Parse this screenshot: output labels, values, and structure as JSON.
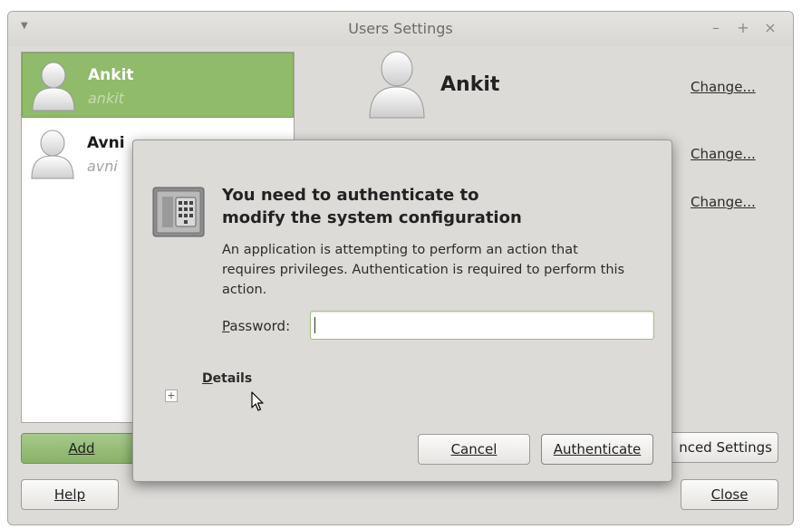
{
  "window": {
    "title": "Users Settings",
    "controls": [
      "–",
      "+",
      "×"
    ]
  },
  "users": [
    {
      "name": "Ankit",
      "login": "ankit",
      "selected": true
    },
    {
      "name": "Avni",
      "login": "avni",
      "selected": false
    }
  ],
  "details": {
    "name": "Ankit",
    "change_label": "Change..."
  },
  "buttons": {
    "add": "Add",
    "advanced_settings": "nced Settings",
    "help": "Help",
    "close": "Close"
  },
  "auth_dialog": {
    "heading_line1": "You need to authenticate to",
    "heading_line2": "modify the system configuration",
    "body_line1": "An application is attempting to perform an action that",
    "body_line2": "requires privileges. Authentication is required to perform this",
    "body_line3": "action.",
    "password_label": "Password:",
    "password_value": "",
    "details_label": "Details",
    "expander_symbol": "+",
    "cancel": "Cancel",
    "authenticate": "Authenticate"
  },
  "colors": {
    "selection": "#8fbb6a",
    "window_bg": "#dddbd8"
  }
}
